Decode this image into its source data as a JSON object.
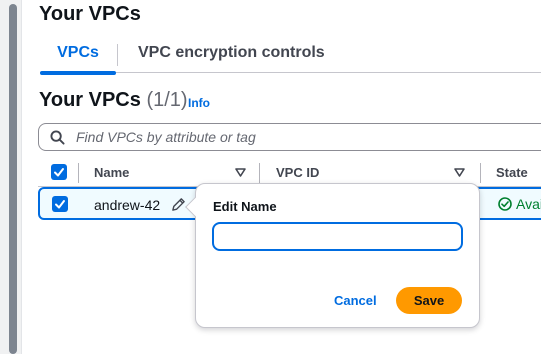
{
  "page": {
    "title": "Your VPCs"
  },
  "tabs": [
    {
      "label": "VPCs",
      "active": true
    },
    {
      "label": "VPC encryption controls",
      "active": false
    }
  ],
  "section": {
    "title": "Your VPCs",
    "count": "(1/1)",
    "info_link": "Info"
  },
  "search": {
    "placeholder": "Find VPCs by attribute or tag",
    "value": ""
  },
  "table": {
    "columns": [
      "Name",
      "VPC ID",
      "State"
    ],
    "rows": [
      {
        "selected": true,
        "name": "andrew-42",
        "vpc_id": "",
        "state": "Available"
      }
    ],
    "state_visible_text": "Avai"
  },
  "edit_popover": {
    "label": "Edit Name",
    "input_value": "",
    "cancel_label": "Cancel",
    "save_label": "Save"
  },
  "colors": {
    "accent": "#006ce0",
    "primary_button": "#ff9900",
    "success": "#00802f",
    "selected_row_bg": "#f0fbff"
  }
}
